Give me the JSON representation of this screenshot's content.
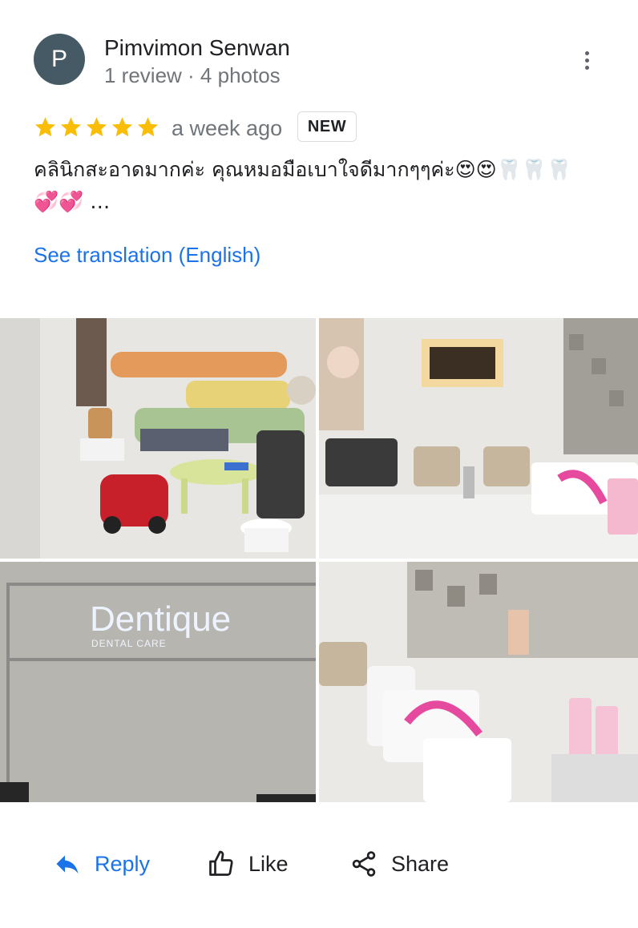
{
  "author": {
    "initial": "P",
    "name": "Pimvimon Senwan",
    "meta": "1 review · 4 photos"
  },
  "review": {
    "rating": 5,
    "time": "a week ago",
    "badge": "NEW",
    "text": "คลินิกสะอาดมากค่ะ คุณหมอมือเบาใจดีมากๆๆค่ะ😍😍🦷🦷🦷💞💞 …",
    "translate_link": "See translation (English)"
  },
  "photos": {
    "sign_text": "Dentique",
    "sign_subtext": "DENTAL CARE"
  },
  "actions": {
    "reply": "Reply",
    "like": "Like",
    "share": "Share"
  },
  "colors": {
    "accent": "#1a73e8",
    "star": "#fbbc04",
    "avatar": "#455a64"
  },
  "icons": [
    "more-vert-icon",
    "star-icon",
    "reply-icon",
    "thumb-up-icon",
    "share-icon"
  ]
}
